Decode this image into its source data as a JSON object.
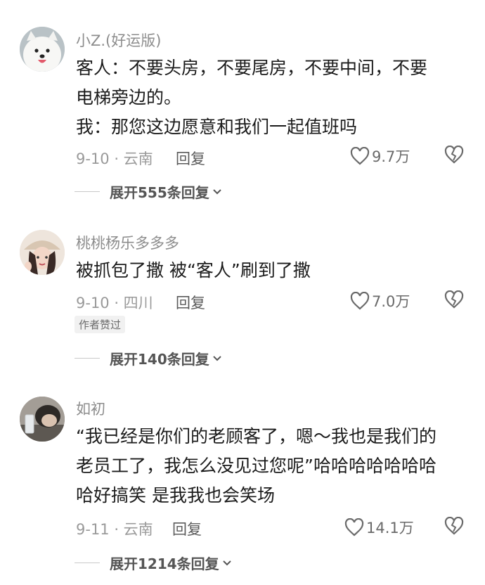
{
  "comments": [
    {
      "username": "小Z.(好运版)",
      "lines": [
        "客人：不要头房，不要尾房，不要中间，不要",
        "电梯旁边的。",
        "我：那您这边愿意和我们一起值班吗"
      ],
      "date_location": "9-10 · 云南",
      "reply_label": "回复",
      "likes": "9.7万",
      "author_badge": null,
      "expand_label": "展开555条回复",
      "avatar": "samoyed-dog-icon"
    },
    {
      "username": "桃桃杨乐多多多",
      "lines": [
        "被抓包了撒 被“客人”刷到了撒"
      ],
      "date_location": "9-10 · 四川",
      "reply_label": "回复",
      "likes": "7.0万",
      "author_badge": "作者赞过",
      "expand_label": "展开140条回复",
      "avatar": "girl-with-hat-avatar"
    },
    {
      "username": "如初",
      "lines": [
        "“我已经是你们的老顾客了，嗯～我也是我们的",
        "老员工了，我怎么没见过您呢”哈哈哈哈哈哈哈",
        "哈好搞笑 是我我也会笑场"
      ],
      "date_location": "9-11 · 云南",
      "reply_label": "回复",
      "likes": "14.1万",
      "author_badge": null,
      "expand_label": "展开1214条回复",
      "avatar": "person-with-glass-avatar"
    }
  ],
  "colors": {
    "username": "#8d8d8d",
    "body": "#1b1b1b",
    "meta": "#9a9a9a",
    "icon": "#6a6a6a"
  }
}
